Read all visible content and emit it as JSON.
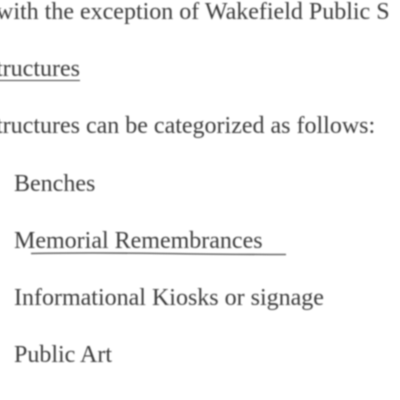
{
  "document": {
    "line_intro": "with the exception of Wakefield Public S",
    "section_heading": "tructures",
    "line_categories": "tructures can be categorized as follows:",
    "list_items": [
      "Benches",
      "Memorial Remembrances",
      "Informational Kiosks or signage",
      "Public Art"
    ]
  }
}
